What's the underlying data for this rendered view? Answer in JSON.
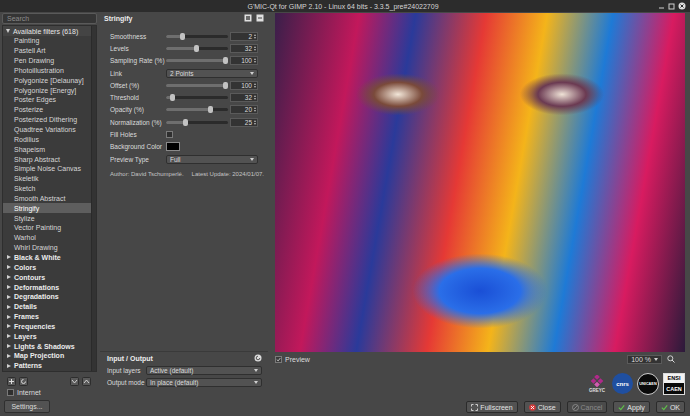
{
  "window": {
    "title": "G'MIC-Qt for GIMP 2.10 - Linux 64 bits - 3.3.5_pre#24022709"
  },
  "filters": {
    "search": {
      "placeholder": "Search"
    },
    "header": {
      "label": "Available filters (618)",
      "expanded": true
    },
    "items": [
      {
        "label": "Painting",
        "kind": "filter",
        "selected": false
      },
      {
        "label": "Pastell Art",
        "kind": "filter",
        "selected": false
      },
      {
        "label": "Pen Drawing",
        "kind": "filter",
        "selected": false
      },
      {
        "label": "Photoillustration",
        "kind": "filter",
        "selected": false
      },
      {
        "label": "Polygonize [Delaunay]",
        "kind": "filter",
        "selected": false
      },
      {
        "label": "Polygonize [Energy]",
        "kind": "filter",
        "selected": false
      },
      {
        "label": "Poster Edges",
        "kind": "filter",
        "selected": false
      },
      {
        "label": "Posterize",
        "kind": "filter",
        "selected": false
      },
      {
        "label": "Posterized Dithering",
        "kind": "filter",
        "selected": false
      },
      {
        "label": "Quadtree Variations",
        "kind": "filter",
        "selected": false
      },
      {
        "label": "Rodilius",
        "kind": "filter",
        "selected": false
      },
      {
        "label": "Shapeism",
        "kind": "filter",
        "selected": false
      },
      {
        "label": "Sharp Abstract",
        "kind": "filter",
        "selected": false
      },
      {
        "label": "Simple Noise Canvas",
        "kind": "filter",
        "selected": false
      },
      {
        "label": "Skeletik",
        "kind": "filter",
        "selected": false
      },
      {
        "label": "Sketch",
        "kind": "filter",
        "selected": false
      },
      {
        "label": "Smooth Abstract",
        "kind": "filter",
        "selected": false
      },
      {
        "label": "Stringify",
        "kind": "filter",
        "selected": true
      },
      {
        "label": "Stylize",
        "kind": "filter",
        "selected": false
      },
      {
        "label": "Vector Painting",
        "kind": "filter",
        "selected": false
      },
      {
        "label": "Warhol",
        "kind": "filter",
        "selected": false
      },
      {
        "label": "Whirl Drawing",
        "kind": "filter",
        "selected": false
      },
      {
        "label": "Black & White",
        "kind": "category",
        "selected": false,
        "expanded": false
      },
      {
        "label": "Colors",
        "kind": "category",
        "selected": false,
        "expanded": false
      },
      {
        "label": "Contours",
        "kind": "category",
        "selected": false,
        "expanded": false
      },
      {
        "label": "Deformations",
        "kind": "category",
        "selected": false,
        "expanded": false
      },
      {
        "label": "Degradations",
        "kind": "category",
        "selected": false,
        "expanded": false
      },
      {
        "label": "Details",
        "kind": "category",
        "selected": false,
        "expanded": false
      },
      {
        "label": "Frames",
        "kind": "category",
        "selected": false,
        "expanded": false
      },
      {
        "label": "Frequencies",
        "kind": "category",
        "selected": false,
        "expanded": false
      },
      {
        "label": "Layers",
        "kind": "category",
        "selected": false,
        "expanded": false
      },
      {
        "label": "Lights & Shadows",
        "kind": "category",
        "selected": false,
        "expanded": false
      },
      {
        "label": "Map Projection",
        "kind": "category",
        "selected": false,
        "expanded": false
      },
      {
        "label": "Patterns",
        "kind": "category",
        "selected": false,
        "expanded": false
      }
    ]
  },
  "internet": {
    "label": "Internet",
    "checked": false
  },
  "settings_button": "Settings...",
  "filter": {
    "title": "Stringify",
    "params": [
      {
        "kind": "slider",
        "label": "Smoothness",
        "value": "2",
        "level": 0.25
      },
      {
        "kind": "slider",
        "label": "Levels",
        "value": "32",
        "level": 0.49
      },
      {
        "kind": "slider",
        "label": "Sampling Rate (%)",
        "value": "100",
        "level": 1
      },
      {
        "kind": "select",
        "label": "Link",
        "value": "2 Points"
      },
      {
        "kind": "slider",
        "label": "Offset (%)",
        "value": "100",
        "level": 1
      },
      {
        "kind": "slider",
        "label": "Threshold",
        "value": "32",
        "level": 0.07
      },
      {
        "kind": "slider",
        "label": "Opacity (%)",
        "value": "20",
        "level": 0.74
      },
      {
        "kind": "slider",
        "label": "Normalization (%)",
        "value": "25",
        "level": 0.29
      },
      {
        "kind": "checkbox",
        "label": "Fill Holes",
        "checked": false
      },
      {
        "kind": "color",
        "label": "Background Color",
        "color": "#000000"
      },
      {
        "kind": "select",
        "label": "Preview Type",
        "value": "Full"
      }
    ],
    "author": "Author: David Tschumperlé.",
    "updated": "Latest Update: 2024/01/07."
  },
  "input_output": {
    "title": "Input / Output",
    "rows": [
      {
        "label": "Input layers",
        "value": "Active (default)"
      },
      {
        "label": "Output mode",
        "value": "In place (default)"
      }
    ]
  },
  "preview": {
    "label": "Preview",
    "checked": true,
    "zoom": "100 %"
  },
  "logos": [
    {
      "kind": "greyc",
      "lines": [
        "GREYC"
      ]
    },
    {
      "kind": "cnrs",
      "lines": [
        "cnrs"
      ]
    },
    {
      "kind": "unicaen",
      "lines": [
        "UNICAEN"
      ]
    },
    {
      "kind": "ensicaen",
      "lines": [
        "ENSI",
        "CAEN"
      ]
    }
  ],
  "buttons": [
    {
      "label": "Fullscreen",
      "disabled": false
    },
    {
      "label": "Close",
      "disabled": false
    },
    {
      "label": "Cancel",
      "disabled": true
    },
    {
      "label": "Apply",
      "disabled": false
    },
    {
      "label": "OK",
      "disabled": false
    }
  ]
}
